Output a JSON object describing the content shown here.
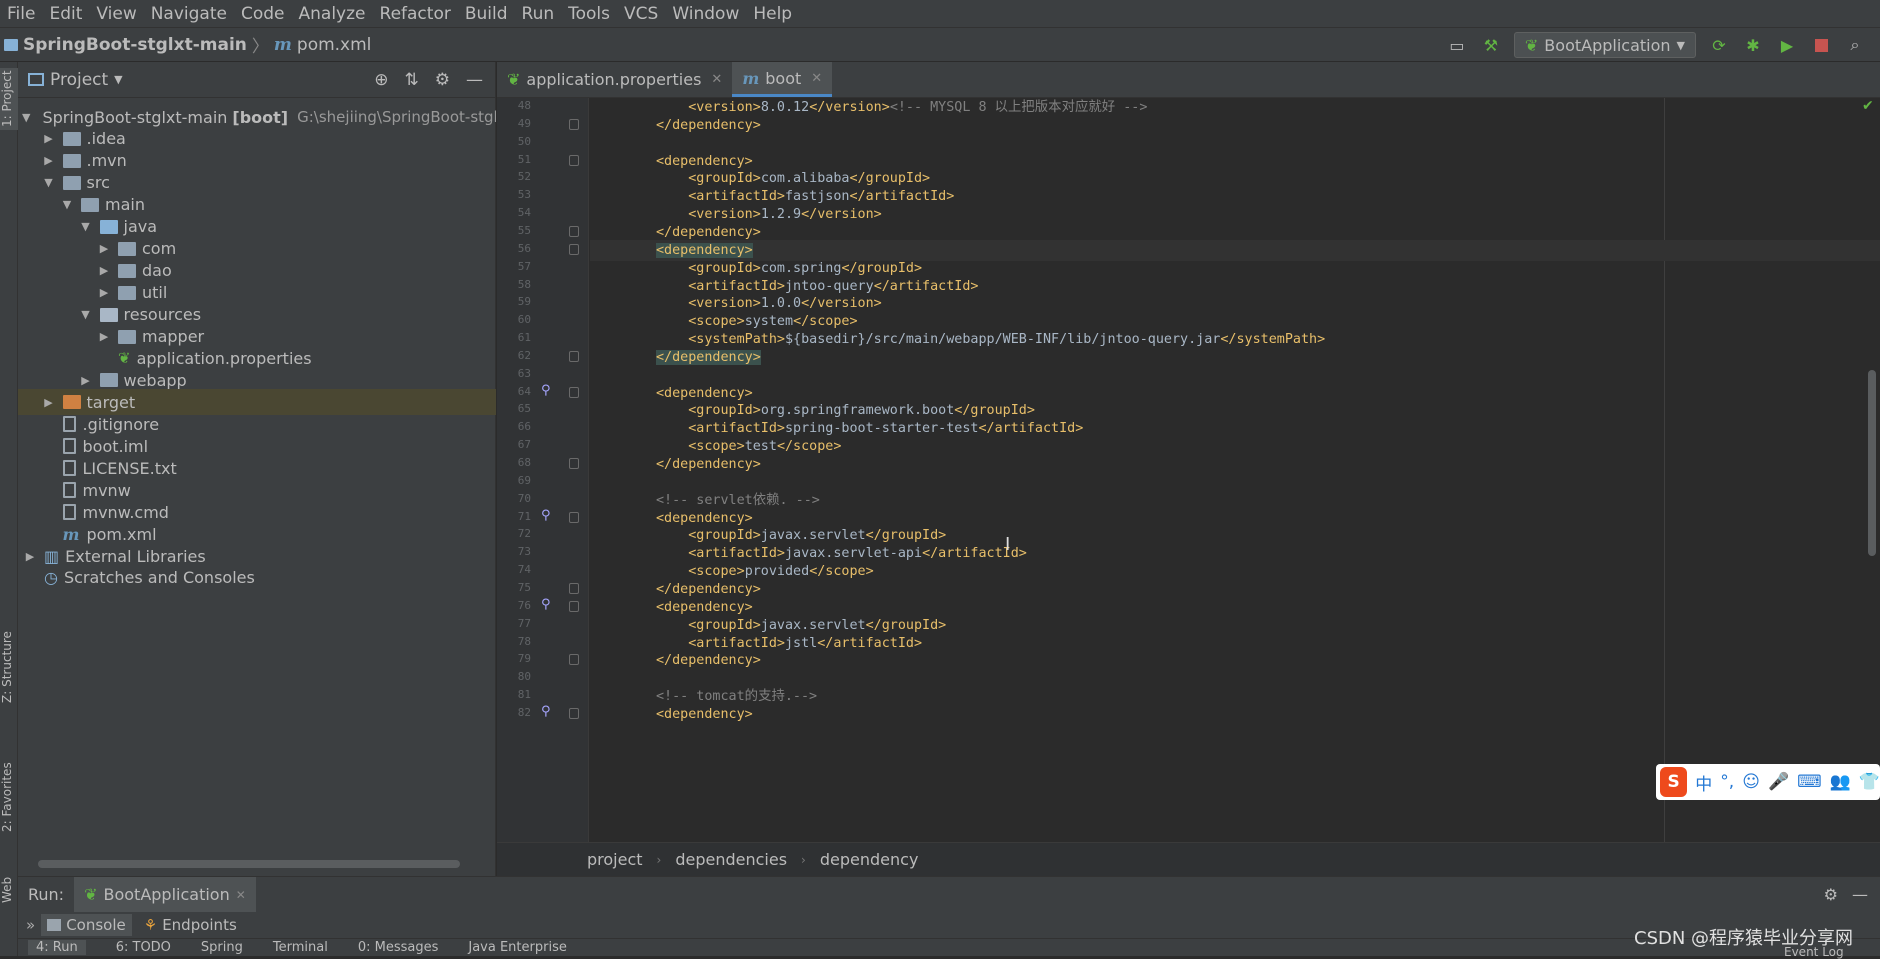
{
  "menu": [
    "File",
    "Edit",
    "View",
    "Navigate",
    "Code",
    "Analyze",
    "Refactor",
    "Build",
    "Run",
    "Tools",
    "VCS",
    "Window",
    "Help"
  ],
  "nav": {
    "project": "SpringBoot-stglxt-main",
    "file": "pom.xml",
    "file_icon": "m",
    "run_config": "BootApplication"
  },
  "left_strip": {
    "project": "1: Project",
    "structure": "Z: Structure",
    "favorites": "2: Favorites",
    "web": "Web"
  },
  "project_panel": {
    "title": "Project",
    "items": [
      {
        "label": "SpringBoot-stglxt-main",
        "extra": "[boot]",
        "path": "G:\\shejiing\\SpringBoot-stgl",
        "depth": 0,
        "expanded": true,
        "icon": "module"
      },
      {
        "label": ".idea",
        "depth": 1,
        "expanded": false,
        "icon": "folder"
      },
      {
        "label": ".mvn",
        "depth": 1,
        "expanded": false,
        "icon": "folder"
      },
      {
        "label": "src",
        "depth": 1,
        "expanded": true,
        "icon": "folder"
      },
      {
        "label": "main",
        "depth": 2,
        "expanded": true,
        "icon": "folder"
      },
      {
        "label": "java",
        "depth": 3,
        "expanded": true,
        "icon": "folder-blue"
      },
      {
        "label": "com",
        "depth": 4,
        "expanded": false,
        "icon": "package"
      },
      {
        "label": "dao",
        "depth": 4,
        "expanded": false,
        "icon": "package"
      },
      {
        "label": "util",
        "depth": 4,
        "expanded": false,
        "icon": "package"
      },
      {
        "label": "resources",
        "depth": 3,
        "expanded": true,
        "icon": "folder-res"
      },
      {
        "label": "mapper",
        "depth": 4,
        "expanded": false,
        "icon": "package"
      },
      {
        "label": "application.properties",
        "depth": 4,
        "icon": "spring-leaf"
      },
      {
        "label": "webapp",
        "depth": 3,
        "expanded": false,
        "icon": "folder"
      },
      {
        "label": "target",
        "depth": 1,
        "expanded": false,
        "icon": "folder-orange",
        "selected": true
      },
      {
        "label": ".gitignore",
        "depth": 1,
        "icon": "file"
      },
      {
        "label": "boot.iml",
        "depth": 1,
        "icon": "file"
      },
      {
        "label": "LICENSE.txt",
        "depth": 1,
        "icon": "file"
      },
      {
        "label": "mvnw",
        "depth": 1,
        "icon": "file"
      },
      {
        "label": "mvnw.cmd",
        "depth": 1,
        "icon": "file"
      },
      {
        "label": "pom.xml",
        "depth": 1,
        "icon": "maven"
      },
      {
        "label": "External Libraries",
        "depth": 0,
        "expanded": false,
        "icon": "libraries"
      },
      {
        "label": "Scratches and Consoles",
        "depth": 0,
        "icon": "scratches"
      }
    ]
  },
  "tabs": [
    {
      "label": "application.properties",
      "icon": "spring-leaf",
      "active": false
    },
    {
      "label": "boot",
      "icon": "m",
      "active": true
    }
  ],
  "editor": {
    "lines": [
      {
        "n": "48",
        "seg": [
          [
            "t",
            "    <version>"
          ],
          [
            "x",
            "8.0.12"
          ],
          [
            "t",
            "</version>"
          ],
          [
            "c",
            "<!-- MYSQL 8 以上把版本对应就好 -->"
          ]
        ]
      },
      {
        "n": "49",
        "seg": [
          [
            "t",
            "</dependency>"
          ]
        ]
      },
      {
        "n": "50",
        "seg": []
      },
      {
        "n": "51",
        "seg": [
          [
            "t",
            "<dependency>"
          ]
        ]
      },
      {
        "n": "52",
        "seg": [
          [
            "t",
            "    <groupId>"
          ],
          [
            "x",
            "com.alibaba"
          ],
          [
            "t",
            "</groupId>"
          ]
        ]
      },
      {
        "n": "53",
        "seg": [
          [
            "t",
            "    <artifactId>"
          ],
          [
            "x",
            "fastjson"
          ],
          [
            "t",
            "</artifactId>"
          ]
        ]
      },
      {
        "n": "54",
        "seg": [
          [
            "t",
            "    <version>"
          ],
          [
            "x",
            "1.2.9"
          ],
          [
            "t",
            "</version>"
          ]
        ]
      },
      {
        "n": "55",
        "seg": [
          [
            "t",
            "</dependency>"
          ]
        ]
      },
      {
        "n": "56",
        "seg": [
          [
            "h",
            "<dependency>"
          ]
        ],
        "current": true
      },
      {
        "n": "57",
        "seg": [
          [
            "t",
            "    <groupId>"
          ],
          [
            "x",
            "com.spring"
          ],
          [
            "t",
            "</groupId>"
          ]
        ]
      },
      {
        "n": "58",
        "seg": [
          [
            "t",
            "    <artifactId>"
          ],
          [
            "x",
            "jntoo-query"
          ],
          [
            "t",
            "</artifactId>"
          ]
        ]
      },
      {
        "n": "59",
        "seg": [
          [
            "t",
            "    <version>"
          ],
          [
            "x",
            "1.0.0"
          ],
          [
            "t",
            "</version>"
          ]
        ]
      },
      {
        "n": "60",
        "seg": [
          [
            "t",
            "    <scope>"
          ],
          [
            "x",
            "system"
          ],
          [
            "t",
            "</scope>"
          ]
        ]
      },
      {
        "n": "61",
        "seg": [
          [
            "t",
            "    <systemPath>"
          ],
          [
            "x",
            "${basedir}/src/main/webapp/WEB-INF/lib/jntoo-query.jar"
          ],
          [
            "t",
            "</systemPath>"
          ]
        ]
      },
      {
        "n": "62",
        "seg": [
          [
            "h",
            "</dependency>"
          ]
        ]
      },
      {
        "n": "63",
        "seg": []
      },
      {
        "n": "64",
        "seg": [
          [
            "t",
            "<dependency>"
          ]
        ],
        "gicon": true
      },
      {
        "n": "65",
        "seg": [
          [
            "t",
            "    <groupId>"
          ],
          [
            "x",
            "org.springframework.boot"
          ],
          [
            "t",
            "</groupId>"
          ]
        ]
      },
      {
        "n": "66",
        "seg": [
          [
            "t",
            "    <artifactId>"
          ],
          [
            "x",
            "spring-boot-starter-test"
          ],
          [
            "t",
            "</artifactId>"
          ]
        ]
      },
      {
        "n": "67",
        "seg": [
          [
            "t",
            "    <scope>"
          ],
          [
            "x",
            "test"
          ],
          [
            "t",
            "</scope>"
          ]
        ]
      },
      {
        "n": "68",
        "seg": [
          [
            "t",
            "</dependency>"
          ]
        ]
      },
      {
        "n": "69",
        "seg": []
      },
      {
        "n": "70",
        "seg": [
          [
            "c",
            "<!-- servlet依赖. -->"
          ]
        ]
      },
      {
        "n": "71",
        "seg": [
          [
            "t",
            "<dependency>"
          ]
        ],
        "gicon": true
      },
      {
        "n": "72",
        "seg": [
          [
            "t",
            "    <groupId>"
          ],
          [
            "x",
            "javax.servlet"
          ],
          [
            "t",
            "</groupId>"
          ]
        ]
      },
      {
        "n": "73",
        "seg": [
          [
            "t",
            "    <artifactId>"
          ],
          [
            "x",
            "javax.servlet-api"
          ],
          [
            "t",
            "</artifactId>"
          ]
        ]
      },
      {
        "n": "74",
        "seg": [
          [
            "t",
            "    <scope>"
          ],
          [
            "x",
            "provided"
          ],
          [
            "t",
            "</scope>"
          ]
        ]
      },
      {
        "n": "75",
        "seg": [
          [
            "t",
            "</dependency>"
          ]
        ]
      },
      {
        "n": "76",
        "seg": [
          [
            "t",
            "<dependency>"
          ]
        ],
        "gicon": true
      },
      {
        "n": "77",
        "seg": [
          [
            "t",
            "    <groupId>"
          ],
          [
            "x",
            "javax.servlet"
          ],
          [
            "t",
            "</groupId>"
          ]
        ]
      },
      {
        "n": "78",
        "seg": [
          [
            "t",
            "    <artifactId>"
          ],
          [
            "x",
            "jstl"
          ],
          [
            "t",
            "</artifactId>"
          ]
        ]
      },
      {
        "n": "79",
        "seg": [
          [
            "t",
            "</dependency>"
          ]
        ]
      },
      {
        "n": "80",
        "seg": []
      },
      {
        "n": "81",
        "seg": [
          [
            "c",
            "<!-- tomcat的支持.-->"
          ]
        ]
      },
      {
        "n": "82",
        "seg": [
          [
            "t",
            "<dependency>"
          ]
        ],
        "gicon": true
      }
    ]
  },
  "breadcrumb": [
    "project",
    "dependencies",
    "dependency"
  ],
  "run": {
    "label": "Run:",
    "config": "BootApplication",
    "console": "Console",
    "endpoints": "Endpoints"
  },
  "bottom_tabs": [
    "4: Run",
    "6: TODO",
    "Spring",
    "Terminal",
    "0: Messages",
    "Java Enterprise"
  ],
  "ime": {
    "logo": "S",
    "items": [
      "中",
      "°,",
      "☺",
      "🎤",
      "⌨",
      "👥",
      "👕"
    ]
  },
  "watermark": "CSDN @程序猿毕业分享网",
  "event_log": "Event Log",
  "colors": {
    "bg": "#2b2b2b",
    "panel": "#3c3f41",
    "tag": "#e8bf6a",
    "comment": "#808080",
    "text": "#a9b7c6",
    "accent": "#4a88c7"
  }
}
